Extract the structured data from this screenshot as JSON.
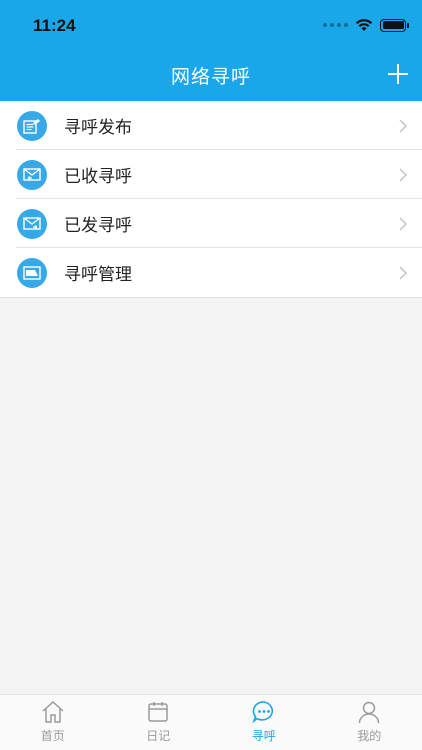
{
  "status_bar": {
    "time": "11:24"
  },
  "nav": {
    "title": "网络寻呼"
  },
  "list": [
    {
      "label": "寻呼发布",
      "icon": "document-edit-icon"
    },
    {
      "label": "已收寻呼",
      "icon": "mail-inbox-icon"
    },
    {
      "label": "已发寻呼",
      "icon": "mail-sent-icon"
    },
    {
      "label": "寻呼管理",
      "icon": "image-manage-icon"
    }
  ],
  "tabs": [
    {
      "label": "首页",
      "icon": "home-icon",
      "active": false
    },
    {
      "label": "日记",
      "icon": "calendar-icon",
      "active": false
    },
    {
      "label": "寻呼",
      "icon": "chat-bubble-icon",
      "active": true
    },
    {
      "label": "我的",
      "icon": "user-icon",
      "active": false
    }
  ],
  "colors": {
    "accent": "#1aa7ea",
    "icon_circle": "#36a9e6",
    "background": "#f4f4f4"
  }
}
